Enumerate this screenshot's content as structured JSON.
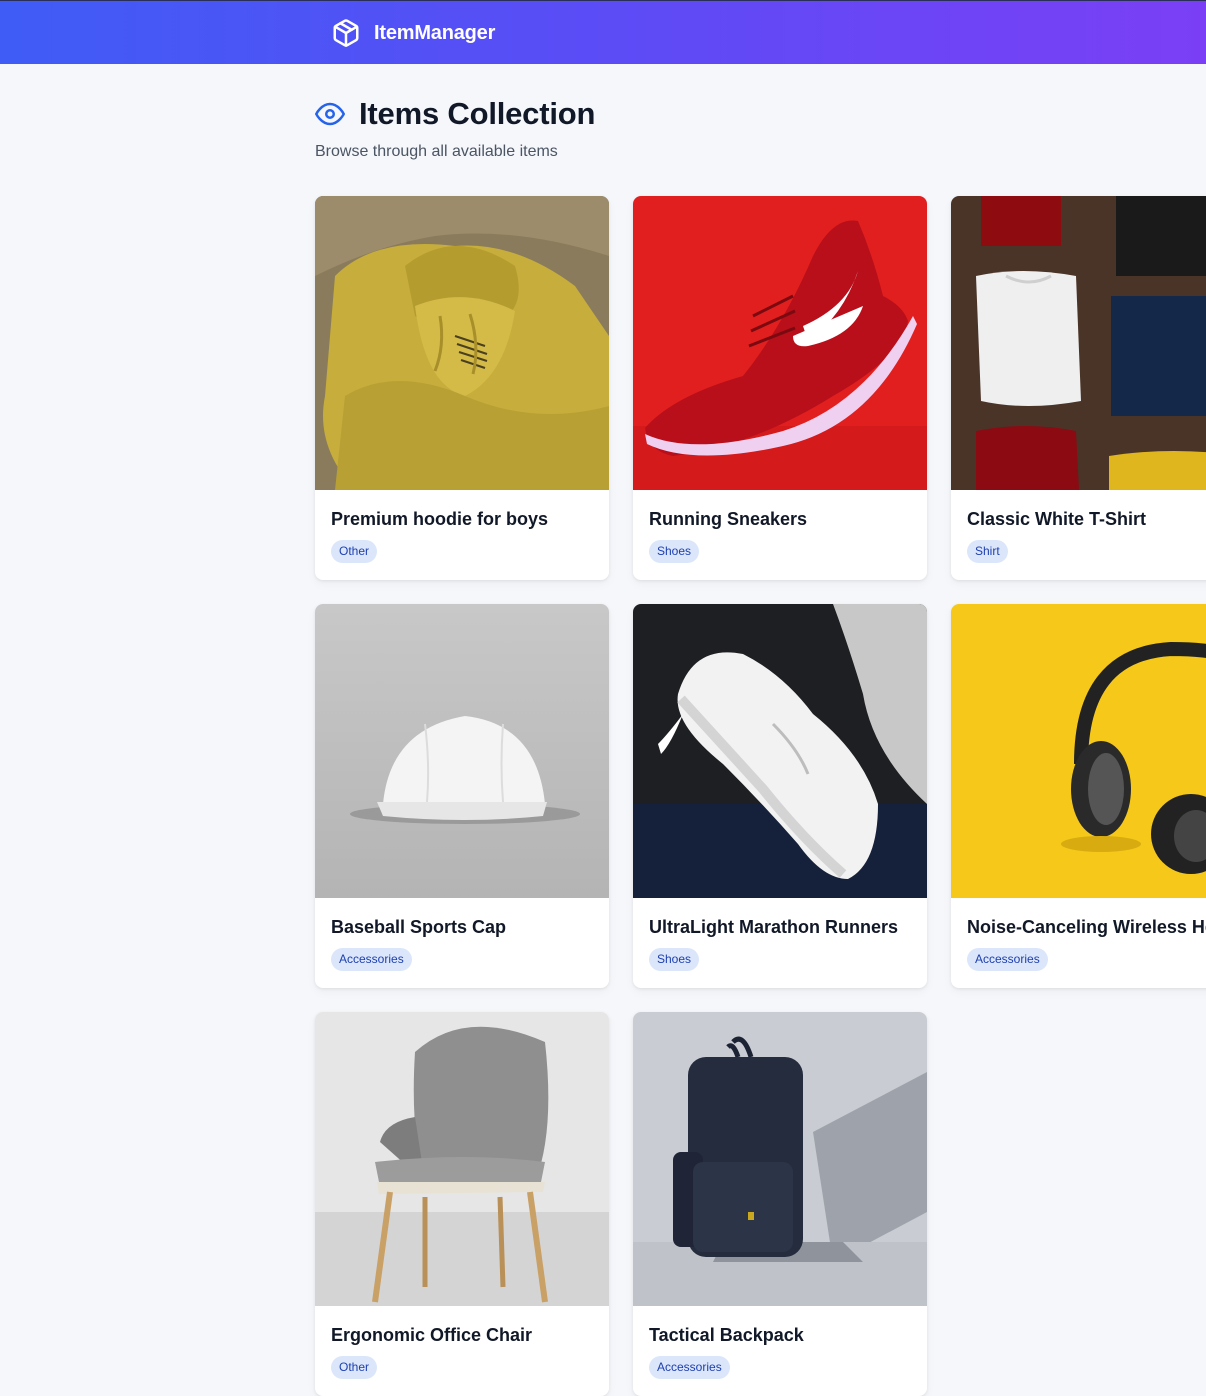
{
  "navbar": {
    "brand_icon": "cube-icon",
    "brand_name": "ItemManager",
    "gradient_start": "#3f5cf6",
    "gradient_end": "#7b3ff5"
  },
  "page": {
    "title_icon": "eye-icon",
    "title": "Items Collection",
    "subtitle": "Browse through all available items"
  },
  "items": [
    {
      "name": "Premium hoodie for boys",
      "category": "Other",
      "image": "yellow-hoodie-photo"
    },
    {
      "name": "Running Sneakers",
      "category": "Shoes",
      "image": "red-nike-sneaker-photo"
    },
    {
      "name": "Classic White T-Shirt",
      "category": "Shirt",
      "image": "folded-tshirts-photo"
    },
    {
      "name": "Baseball Sports Cap",
      "category": "Accessories",
      "image": "white-cap-photo"
    },
    {
      "name": "UltraLight Marathon Runners",
      "category": "Shoes",
      "image": "white-nike-sneaker-photo"
    },
    {
      "name": "Noise-Canceling Wireless Headphones",
      "category": "Accessories",
      "image": "black-headphones-photo"
    },
    {
      "name": "Ergonomic Office Chair",
      "category": "Other",
      "image": "grey-chair-photo"
    },
    {
      "name": "Tactical Backpack",
      "category": "Accessories",
      "image": "navy-backpack-photo"
    }
  ]
}
